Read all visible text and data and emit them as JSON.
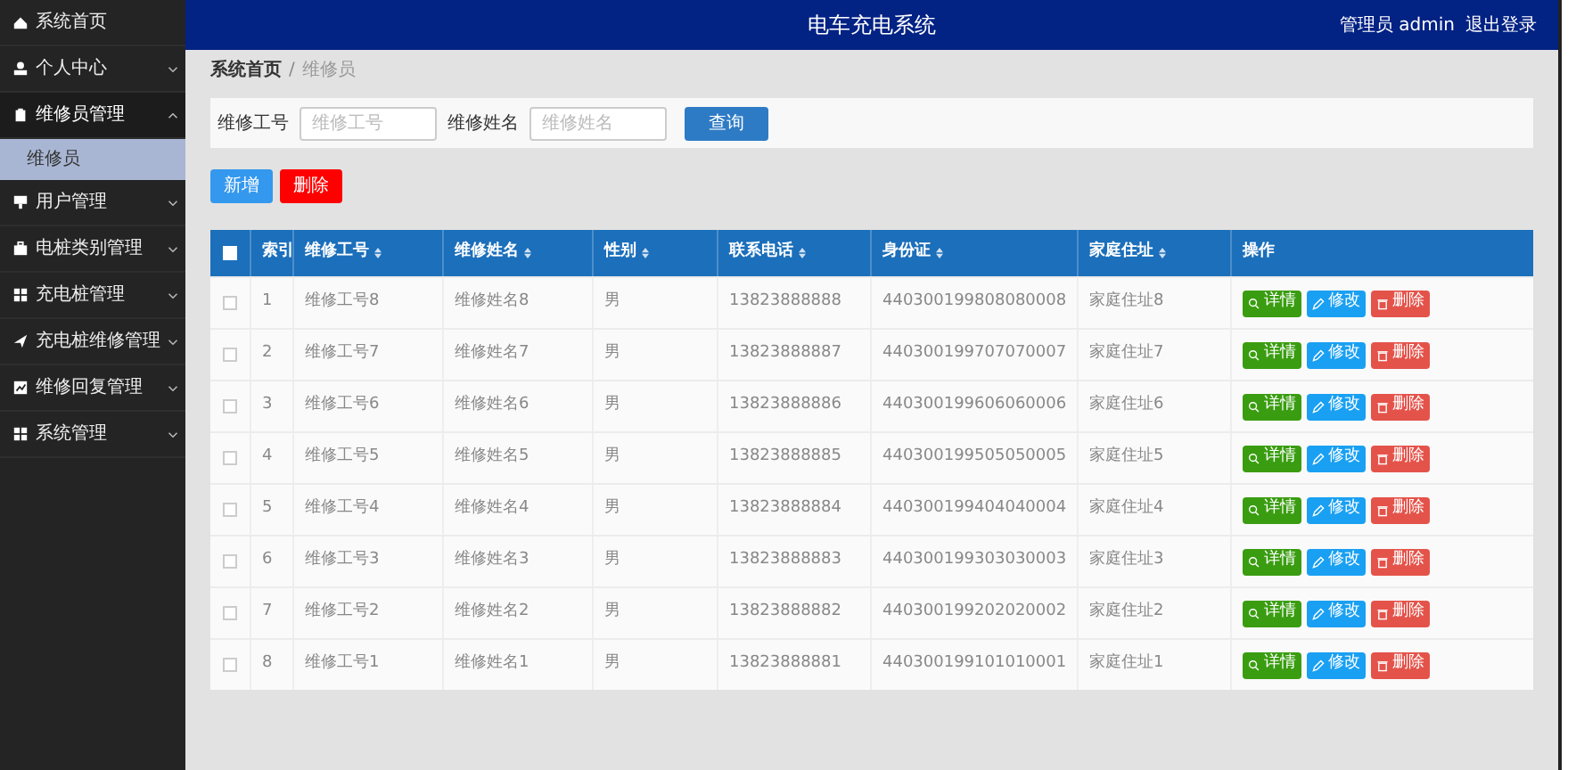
{
  "header": {
    "title": "电车充电系统",
    "user": "管理员 admin",
    "logout": "退出登录"
  },
  "sidebar": {
    "items": [
      {
        "label": "系统首页",
        "kind": "link",
        "expanded": false
      },
      {
        "label": "个人中心",
        "kind": "menu",
        "expanded": false
      },
      {
        "label": "维修员管理",
        "kind": "menu",
        "expanded": true,
        "children": [
          {
            "label": "维修员",
            "selected": true
          }
        ]
      },
      {
        "label": "用户管理",
        "kind": "menu",
        "expanded": false
      },
      {
        "label": "电桩类别管理",
        "kind": "menu",
        "expanded": false
      },
      {
        "label": "充电桩管理",
        "kind": "menu",
        "expanded": false
      },
      {
        "label": "充电桩维修管理",
        "kind": "menu",
        "expanded": false
      },
      {
        "label": "维修回复管理",
        "kind": "menu",
        "expanded": false
      },
      {
        "label": "系统管理",
        "kind": "menu",
        "expanded": false
      }
    ]
  },
  "breadcrumb": {
    "items": [
      "系统首页",
      "维修员"
    ],
    "separator": "/"
  },
  "search": {
    "fields": [
      {
        "label": "维修工号",
        "placeholder": "维修工号"
      },
      {
        "label": "维修姓名",
        "placeholder": "维修姓名"
      }
    ],
    "button": "查询"
  },
  "actions": [
    {
      "label": "新增",
      "kind": "add"
    },
    {
      "label": "删除",
      "kind": "delete"
    }
  ],
  "table": {
    "select_all": false,
    "columns": [
      {
        "label": "索引",
        "sortable": false
      },
      {
        "label": "维修工号",
        "sortable": true
      },
      {
        "label": "维修姓名",
        "sortable": true
      },
      {
        "label": "性别",
        "sortable": true
      },
      {
        "label": "联系电话",
        "sortable": true
      },
      {
        "label": "身份证",
        "sortable": true
      },
      {
        "label": "家庭住址",
        "sortable": true
      },
      {
        "label": "操作",
        "sortable": false
      }
    ],
    "rows": [
      {
        "checked": false,
        "cells": [
          "1",
          "维修工号8",
          "维修姓名8",
          "男",
          "13823888888",
          "440300199808080008",
          "家庭住址8"
        ],
        "buttons": [
          {
            "label": "详情",
            "kind": "detail"
          },
          {
            "label": "修改",
            "kind": "edit"
          },
          {
            "label": "删除",
            "kind": "delete"
          }
        ]
      },
      {
        "checked": false,
        "cells": [
          "2",
          "维修工号7",
          "维修姓名7",
          "男",
          "13823888887",
          "440300199707070007",
          "家庭住址7"
        ],
        "buttons": [
          {
            "label": "详情",
            "kind": "detail"
          },
          {
            "label": "修改",
            "kind": "edit"
          },
          {
            "label": "删除",
            "kind": "delete"
          }
        ]
      },
      {
        "checked": false,
        "cells": [
          "3",
          "维修工号6",
          "维修姓名6",
          "男",
          "13823888886",
          "440300199606060006",
          "家庭住址6"
        ],
        "buttons": [
          {
            "label": "详情",
            "kind": "detail"
          },
          {
            "label": "修改",
            "kind": "edit"
          },
          {
            "label": "删除",
            "kind": "delete"
          }
        ]
      },
      {
        "checked": false,
        "cells": [
          "4",
          "维修工号5",
          "维修姓名5",
          "男",
          "13823888885",
          "440300199505050005",
          "家庭住址5"
        ],
        "buttons": [
          {
            "label": "详情",
            "kind": "detail"
          },
          {
            "label": "修改",
            "kind": "edit"
          },
          {
            "label": "删除",
            "kind": "delete"
          }
        ]
      },
      {
        "checked": false,
        "cells": [
          "5",
          "维修工号4",
          "维修姓名4",
          "男",
          "13823888884",
          "440300199404040004",
          "家庭住址4"
        ],
        "buttons": [
          {
            "label": "详情",
            "kind": "detail"
          },
          {
            "label": "修改",
            "kind": "edit"
          },
          {
            "label": "删除",
            "kind": "delete"
          }
        ]
      },
      {
        "checked": false,
        "cells": [
          "6",
          "维修工号3",
          "维修姓名3",
          "男",
          "13823888883",
          "440300199303030003",
          "家庭住址3"
        ],
        "buttons": [
          {
            "label": "详情",
            "kind": "detail"
          },
          {
            "label": "修改",
            "kind": "edit"
          },
          {
            "label": "删除",
            "kind": "delete"
          }
        ]
      },
      {
        "checked": false,
        "cells": [
          "7",
          "维修工号2",
          "维修姓名2",
          "男",
          "13823888882",
          "440300199202020002",
          "家庭住址2"
        ],
        "buttons": [
          {
            "label": "详情",
            "kind": "detail"
          },
          {
            "label": "修改",
            "kind": "edit"
          },
          {
            "label": "删除",
            "kind": "delete"
          }
        ]
      },
      {
        "checked": false,
        "cells": [
          "8",
          "维修工号1",
          "维修姓名1",
          "男",
          "13823888881",
          "440300199101010001",
          "家庭住址1"
        ],
        "buttons": [
          {
            "label": "详情",
            "kind": "detail"
          },
          {
            "label": "修改",
            "kind": "edit"
          },
          {
            "label": "删除",
            "kind": "delete"
          }
        ]
      }
    ]
  }
}
